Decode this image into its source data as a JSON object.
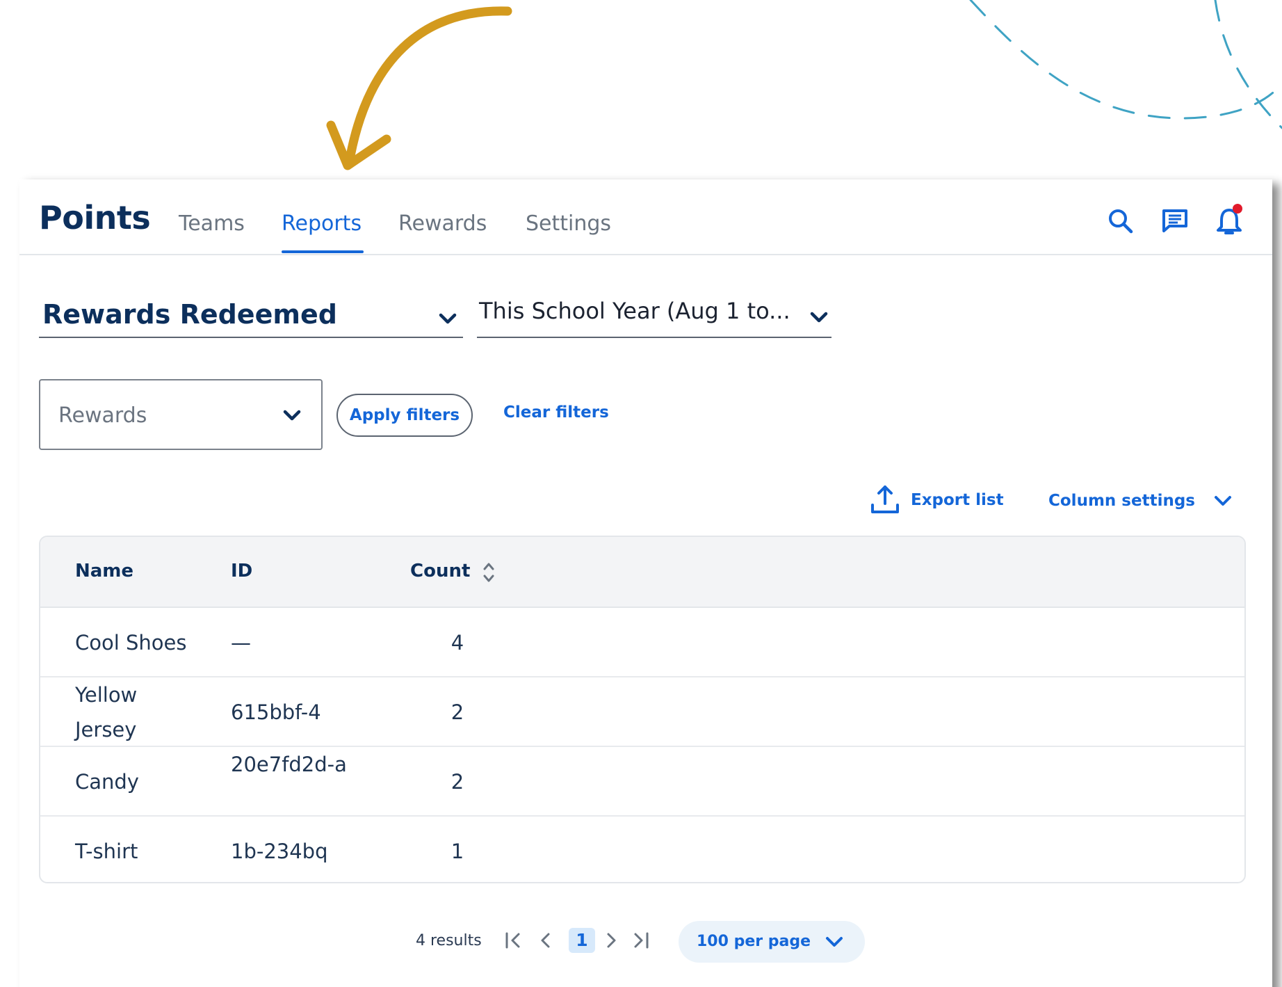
{
  "header": {
    "brand": "Points",
    "tabs": [
      {
        "label": "Teams",
        "active": false
      },
      {
        "label": "Reports",
        "active": true
      },
      {
        "label": "Rewards",
        "active": false
      },
      {
        "label": "Settings",
        "active": false
      }
    ],
    "icons": [
      "search-icon",
      "chat-icon",
      "bell-icon"
    ],
    "has_notification": true
  },
  "report": {
    "selected_report": "Rewards Redeemed",
    "selected_date_range": "This School Year (Aug 1 to..."
  },
  "filters": {
    "rewards_label": "Rewards",
    "apply_label": "Apply filters",
    "clear_label": "Clear filters"
  },
  "toolbar": {
    "export_label": "Export list",
    "column_settings_label": "Column settings"
  },
  "table": {
    "columns": [
      "Name",
      "ID",
      "Count"
    ],
    "rows": [
      {
        "name": "Cool Shoes",
        "id": "—",
        "count": "4"
      },
      {
        "name": "Yellow Jersey",
        "id": "615bbf-4",
        "count": "2"
      },
      {
        "name": "Candy",
        "id": "20e7fd2d-a",
        "count": "2"
      },
      {
        "name": "T-shirt",
        "id": "1b-234bq",
        "count": "1"
      }
    ]
  },
  "pagination": {
    "results": "4 results",
    "current_page": "1",
    "per_page": "100 per page"
  },
  "colors": {
    "brand_navy": "#0c2f5c",
    "accent_blue": "#1466d8",
    "arrow_gold": "#d39a1e",
    "dash_teal": "#3fa3c4",
    "notification_red": "#e11a2b"
  }
}
